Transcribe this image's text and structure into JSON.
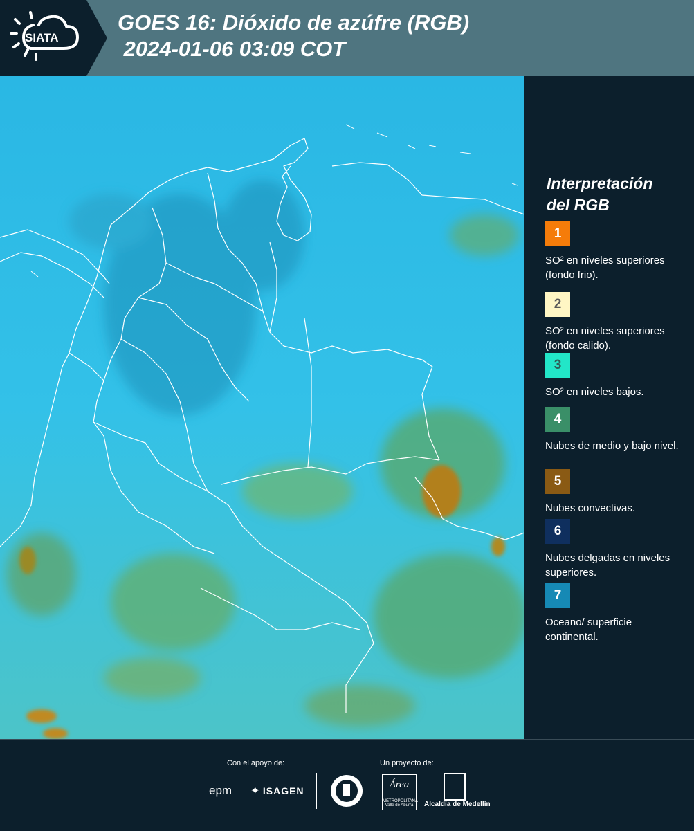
{
  "header": {
    "logo_text": "SIATA",
    "title_line1": "GOES 16: Dióxido de azúfre (RGB)",
    "title_line2": " 2024-01-06 03:09 COT"
  },
  "legend": {
    "title_line1": "Interpretación",
    "title_line2": "del RGB",
    "items": [
      {
        "number": "1",
        "color": "#f57c0a",
        "num_color": "#ffffff",
        "text": "SO² en niveles superiores (fondo frio)."
      },
      {
        "number": "2",
        "color": "#fff6c4",
        "num_color": "#5a5a5a",
        "text": "SO² en niveles superiores (fondo calido)."
      },
      {
        "number": "3",
        "color": "#22e6c8",
        "num_color": "#2f5f58",
        "text": "SO² en niveles bajos."
      },
      {
        "number": "4",
        "color": "#3a8f68",
        "num_color": "#ffffff",
        "text": "Nubes de medio y bajo nivel."
      },
      {
        "number": "5",
        "color": "#8a5a14",
        "num_color": "#ffffff",
        "text": "Nubes convectivas."
      },
      {
        "number": "6",
        "color": "#0f2f5e",
        "num_color": "#ffffff",
        "text": "Nubes delgadas en niveles superiores."
      },
      {
        "number": "7",
        "color": "#1689b5",
        "num_color": "#ffffff",
        "text": "Oceano/ superficie continental."
      }
    ]
  },
  "footer": {
    "support_label": "Con el apoyo de:",
    "project_label": "Un proyecto de:",
    "sponsor1": "epm",
    "sponsor2": "ISAGEN",
    "partner_area": "Área",
    "partner_area_sub": "METROPOLITANA",
    "partner_area_sub2": "Valle de Aburrá",
    "partner_alcaldia": "Alcaldía de Medellín"
  },
  "colors": {
    "background": "#0c1f2c",
    "header": "#4f7580",
    "ocean": "#1fb6e6",
    "cloud_green": "#5aa868",
    "convective": "#b2801e"
  }
}
